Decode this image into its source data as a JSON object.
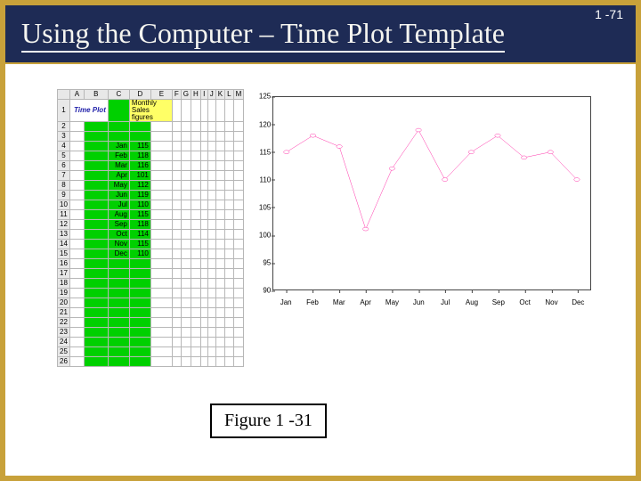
{
  "page_number": "1 -71",
  "title": "Using the Computer – Time Plot Template",
  "figure_caption": "Figure 1 -31",
  "spreadsheet": {
    "col_headers": [
      "",
      "A",
      "B",
      "C",
      "D",
      "E",
      "F",
      "G",
      "H",
      "I",
      "J",
      "K",
      "L",
      "M"
    ],
    "title_cell": "Time Plot",
    "subtitle_cell": "Monthly Sales figures",
    "row_count": 26,
    "data": [
      {
        "r": 4,
        "month": "Jan",
        "val": "115"
      },
      {
        "r": 5,
        "month": "Feb",
        "val": "118"
      },
      {
        "r": 6,
        "month": "Mar",
        "val": "116"
      },
      {
        "r": 7,
        "month": "Apr",
        "val": "101"
      },
      {
        "r": 8,
        "month": "May",
        "val": "112"
      },
      {
        "r": 9,
        "month": "Jun",
        "val": "119"
      },
      {
        "r": 10,
        "month": "Jul",
        "val": "110"
      },
      {
        "r": 11,
        "month": "Aug",
        "val": "115"
      },
      {
        "r": 12,
        "month": "Sep",
        "val": "118"
      },
      {
        "r": 13,
        "month": "Oct",
        "val": "114"
      },
      {
        "r": 14,
        "month": "Nov",
        "val": "115"
      },
      {
        "r": 15,
        "month": "Dec",
        "val": "110"
      }
    ]
  },
  "chart_data": {
    "type": "line",
    "title": "",
    "xlabel": "",
    "ylabel": "",
    "categories": [
      "Jan",
      "Feb",
      "Mar",
      "Apr",
      "May",
      "Jun",
      "Jul",
      "Aug",
      "Sep",
      "Oct",
      "Nov",
      "Dec"
    ],
    "values": [
      115,
      118,
      116,
      101,
      112,
      119,
      110,
      115,
      118,
      114,
      115,
      110
    ],
    "ylim": [
      90,
      125
    ],
    "yticks": [
      90,
      95,
      100,
      105,
      110,
      115,
      120,
      125
    ],
    "series_color": "#ff33aa",
    "marker": "circle"
  }
}
